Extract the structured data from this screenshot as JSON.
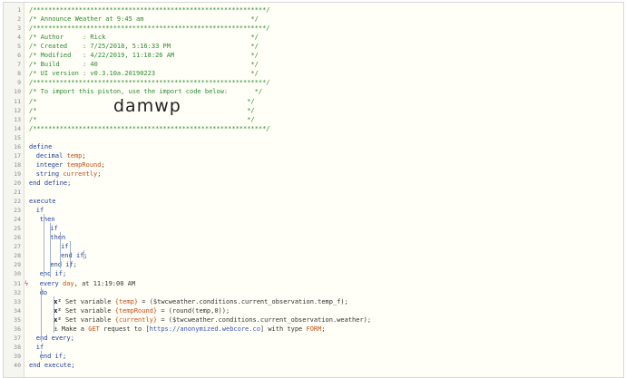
{
  "code_lines": [
    {
      "n": "1",
      "t": "/*************************************************************/"
    },
    {
      "n": "2",
      "t": "/* Announce Weather at 9:45 am                            */"
    },
    {
      "n": "3",
      "t": "/*************************************************************/"
    },
    {
      "n": "4",
      "t": "/* Author     : Rick                                      */"
    },
    {
      "n": "5",
      "t": "/* Created    : 7/25/2018, 5:16:33 PM                     */"
    },
    {
      "n": "6",
      "t": "/* Modified   : 4/22/2019, 11:18:26 AM                    */"
    },
    {
      "n": "7",
      "t": "/* Build      : 40                                        */"
    },
    {
      "n": "8",
      "t": "/* UI version : v0.3.10a.20190223                         */"
    },
    {
      "n": "9",
      "t": "/*************************************************************/"
    },
    {
      "n": "10",
      "t": "/* To import this piston, use the import code below:       */"
    },
    {
      "n": "11",
      "t": "/*                                                       */"
    },
    {
      "n": "12",
      "t": "/*                                                       */"
    },
    {
      "n": "13",
      "t": "/*                                                       */"
    },
    {
      "n": "14",
      "t": "/*************************************************************/"
    },
    {
      "n": "15",
      "t": ""
    },
    {
      "n": "16",
      "t": "define"
    },
    {
      "n": "17",
      "t": "decimal temp;"
    },
    {
      "n": "18",
      "t": "integer tempRound;"
    },
    {
      "n": "19",
      "t": "string currently;"
    },
    {
      "n": "20",
      "t": "end define;"
    },
    {
      "n": "21",
      "t": ""
    },
    {
      "n": "22",
      "t": "execute"
    },
    {
      "n": "23",
      "t": "if"
    },
    {
      "n": "24",
      "t": "then"
    },
    {
      "n": "25",
      "t": "if"
    },
    {
      "n": "26",
      "t": "then"
    },
    {
      "n": "27",
      "t": "if"
    },
    {
      "n": "28",
      "t": "end if;"
    },
    {
      "n": "29",
      "t": "end if;"
    },
    {
      "n": "30",
      "t": "end if;"
    },
    {
      "n": "31",
      "t": "every day, at 11:19:00 AM"
    },
    {
      "n": "32",
      "t": "do"
    },
    {
      "n": "33",
      "t": "Set variable {temp} = ($twcweather.conditions.current_observation.temp_f);"
    },
    {
      "n": "34",
      "t": "Set variable {tempRound} = (round(temp,0));"
    },
    {
      "n": "35",
      "t": "Set variable {currently} = ($twcweather.conditions.current_observation.weather);"
    },
    {
      "n": "36",
      "t": "Make a GET request to [https://anonymized.webcore.co] with type FORM;"
    },
    {
      "n": "37",
      "t": "end every;"
    },
    {
      "n": "38",
      "t": "if"
    },
    {
      "n": "39",
      "t": "end if;"
    },
    {
      "n": "40",
      "t": "end execute;"
    }
  ],
  "import_code": "damwp",
  "icons": {
    "set_variable": "x-squared-icon",
    "http_request": "anchor-icon",
    "trigger_marker": "lightning-icon"
  },
  "colors": {
    "comment": "#2c8a2c",
    "keyword": "#1f3d96",
    "variable": "#c24e13",
    "trigger": "#c2188c"
  }
}
